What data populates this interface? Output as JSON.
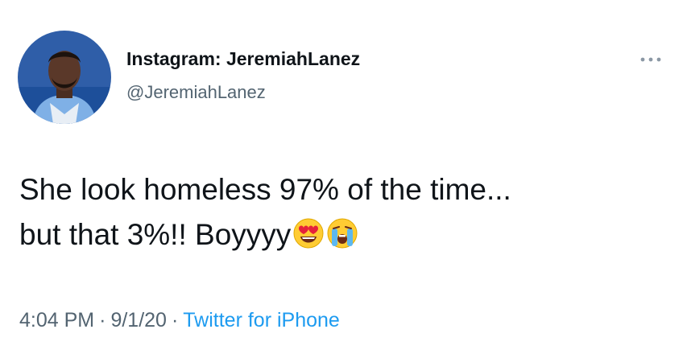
{
  "author": {
    "display_name": "Instagram: JeremiahLanez",
    "handle": "@JeremiahLanez"
  },
  "tweet": {
    "line1": "She look homeless 97% of the time...",
    "line2": "but that 3%!! Boyyyy",
    "emojis": [
      "heart-eyes-emoji",
      "loudly-crying-emoji"
    ]
  },
  "meta": {
    "time": "4:04 PM",
    "separator": "·",
    "date": "9/1/20",
    "source": "Twitter for iPhone"
  },
  "colors": {
    "text": "#0f1419",
    "secondary": "#536471",
    "link": "#1d9bf0"
  },
  "icons": {
    "more": "more-options-icon"
  }
}
